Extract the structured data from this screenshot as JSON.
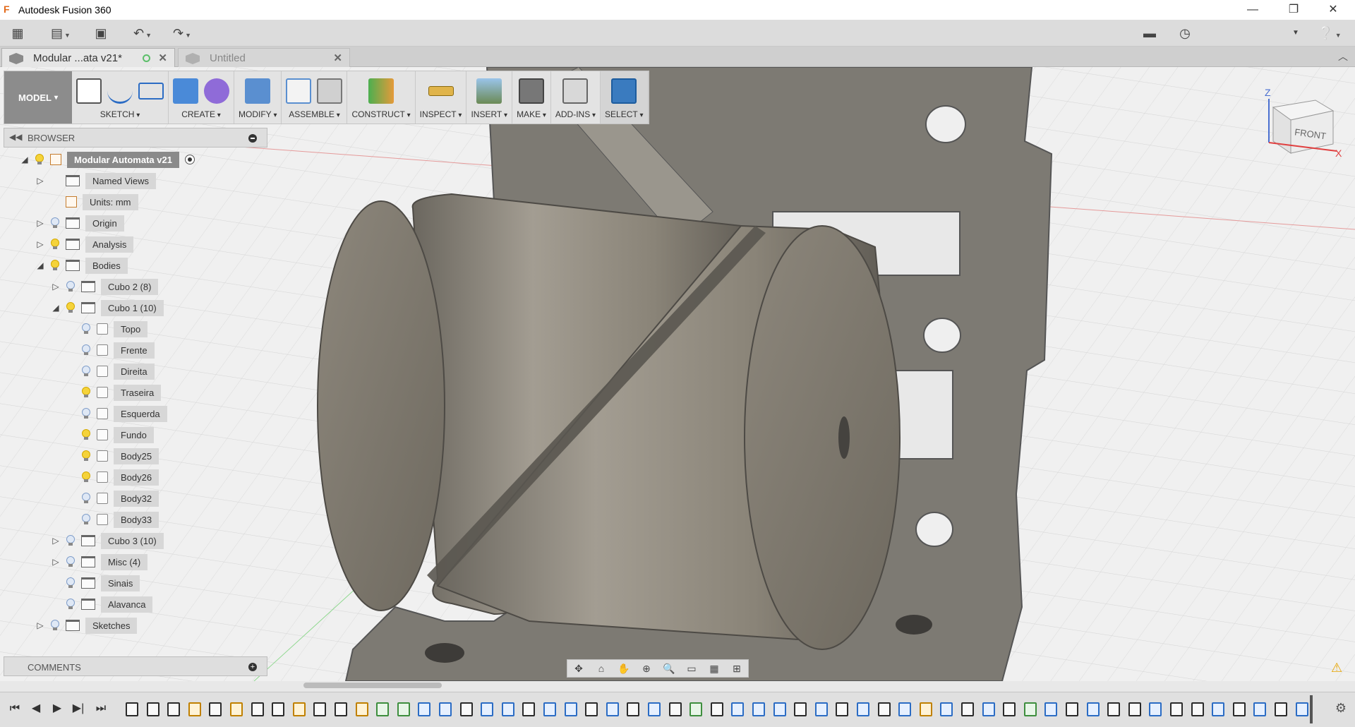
{
  "window": {
    "title": "Autodesk Fusion 360",
    "minimize": "—",
    "restore": "❐",
    "close": "✕"
  },
  "quick_access": {
    "grid_icon": "grid-icon",
    "file_icon": "file-icon",
    "save_icon": "save-icon",
    "undo_icon": "undo-icon",
    "redo_icon": "redo-icon",
    "comment_icon": "comment-icon",
    "clock_icon": "clock-icon",
    "help_icon": "help-icon"
  },
  "tabs": [
    {
      "label": "Modular ...ata v21*",
      "active": true
    },
    {
      "label": "Untitled",
      "active": false
    }
  ],
  "toolbar": {
    "workspace": "MODEL",
    "groups": [
      {
        "label": "SKETCH"
      },
      {
        "label": "CREATE"
      },
      {
        "label": "MODIFY"
      },
      {
        "label": "ASSEMBLE"
      },
      {
        "label": "CONSTRUCT"
      },
      {
        "label": "INSPECT"
      },
      {
        "label": "INSERT"
      },
      {
        "label": "MAKE"
      },
      {
        "label": "ADD-INS"
      },
      {
        "label": "SELECT"
      }
    ]
  },
  "browser": {
    "header": "BROWSER",
    "items": [
      {
        "label": "Modular Automata v21",
        "level": 0,
        "expander": "◢",
        "bulb": "on",
        "icon": "doc"
      },
      {
        "label": "Named Views",
        "level": 1,
        "expander": "▷",
        "bulb": "none",
        "icon": "folder"
      },
      {
        "label": "Units: mm",
        "level": 1,
        "expander": "",
        "bulb": "none",
        "icon": "doc"
      },
      {
        "label": "Origin",
        "level": 1,
        "expander": "▷",
        "bulb": "off",
        "icon": "folder"
      },
      {
        "label": "Analysis",
        "level": 1,
        "expander": "▷",
        "bulb": "on",
        "icon": "folder"
      },
      {
        "label": "Bodies",
        "level": 1,
        "expander": "◢",
        "bulb": "on",
        "icon": "folder"
      },
      {
        "label": "Cubo 2 (8)",
        "level": 2,
        "expander": "▷",
        "bulb": "off",
        "icon": "folder"
      },
      {
        "label": "Cubo 1 (10)",
        "level": 2,
        "expander": "◢",
        "bulb": "on",
        "icon": "folder"
      },
      {
        "label": "Topo",
        "level": 3,
        "expander": "",
        "bulb": "off",
        "icon": "body"
      },
      {
        "label": "Frente",
        "level": 3,
        "expander": "",
        "bulb": "off",
        "icon": "body"
      },
      {
        "label": "Direita",
        "level": 3,
        "expander": "",
        "bulb": "off",
        "icon": "body"
      },
      {
        "label": "Traseira",
        "level": 3,
        "expander": "",
        "bulb": "on",
        "icon": "body"
      },
      {
        "label": "Esquerda",
        "level": 3,
        "expander": "",
        "bulb": "off",
        "icon": "body"
      },
      {
        "label": "Fundo",
        "level": 3,
        "expander": "",
        "bulb": "on",
        "icon": "body"
      },
      {
        "label": "Body25",
        "level": 3,
        "expander": "",
        "bulb": "on",
        "icon": "body"
      },
      {
        "label": "Body26",
        "level": 3,
        "expander": "",
        "bulb": "on",
        "icon": "body"
      },
      {
        "label": "Body32",
        "level": 3,
        "expander": "",
        "bulb": "off",
        "icon": "body"
      },
      {
        "label": "Body33",
        "level": 3,
        "expander": "",
        "bulb": "off",
        "icon": "body"
      },
      {
        "label": "Cubo 3 (10)",
        "level": 2,
        "expander": "▷",
        "bulb": "off",
        "icon": "folder"
      },
      {
        "label": "Misc (4)",
        "level": 2,
        "expander": "▷",
        "bulb": "off",
        "icon": "folder"
      },
      {
        "label": "Sinais",
        "level": 2,
        "expander": "",
        "bulb": "off",
        "icon": "folder"
      },
      {
        "label": "Alavanca",
        "level": 2,
        "expander": "",
        "bulb": "off",
        "icon": "folder"
      },
      {
        "label": "Sketches",
        "level": 1,
        "expander": "▷",
        "bulb": "off",
        "icon": "folder"
      }
    ]
  },
  "comments": {
    "header": "COMMENTS"
  },
  "viewcube": {
    "face": "FRONT",
    "axis_z": "Z",
    "axis_x": "X"
  },
  "navbar": {
    "tools": [
      "orbit-icon",
      "look-at-icon",
      "pan-icon",
      "zoom-icon",
      "fit-icon",
      "display-icon",
      "grid-icon",
      "viewports-icon"
    ]
  },
  "timeline": {
    "controls": [
      "⏮",
      "◀",
      "▶",
      "▶|",
      "⏭"
    ],
    "items": [
      "s",
      "s",
      "s",
      "k",
      "s",
      "k",
      "s",
      "s",
      "k",
      "s",
      "s",
      "k",
      "g",
      "g",
      "b",
      "b",
      "s",
      "b",
      "b",
      "s",
      "b",
      "b",
      "s",
      "b",
      "s",
      "b",
      "s",
      "g",
      "s",
      "b",
      "b",
      "b",
      "s",
      "b",
      "s",
      "b",
      "s",
      "b",
      "k",
      "b",
      "s",
      "b",
      "s",
      "g",
      "b",
      "s",
      "b",
      "s",
      "s",
      "b",
      "s",
      "s",
      "b",
      "s",
      "b",
      "s",
      "b"
    ]
  }
}
